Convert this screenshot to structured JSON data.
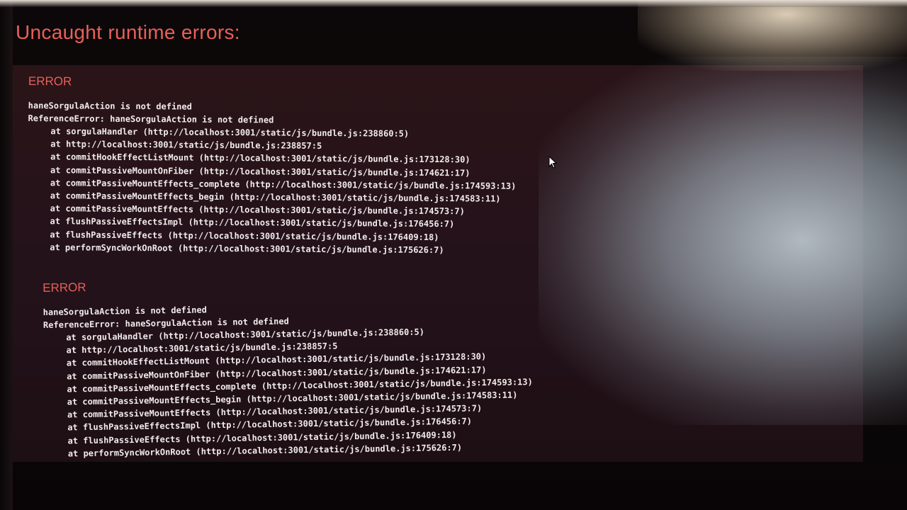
{
  "overlay": {
    "title": "Uncaught runtime errors:"
  },
  "errors": [
    {
      "heading": "ERROR",
      "message": "haneSorgulaAction is not defined",
      "reference_error": "ReferenceError: haneSorgulaAction is not defined",
      "stack": [
        "at sorgulaHandler (http://localhost:3001/static/js/bundle.js:238860:5)",
        "at http://localhost:3001/static/js/bundle.js:238857:5",
        "at commitHookEffectListMount (http://localhost:3001/static/js/bundle.js:173128:30)",
        "at commitPassiveMountOnFiber (http://localhost:3001/static/js/bundle.js:174621:17)",
        "at commitPassiveMountEffects_complete (http://localhost:3001/static/js/bundle.js:174593:13)",
        "at commitPassiveMountEffects_begin (http://localhost:3001/static/js/bundle.js:174583:11)",
        "at commitPassiveMountEffects (http://localhost:3001/static/js/bundle.js:174573:7)",
        "at flushPassiveEffectsImpl (http://localhost:3001/static/js/bundle.js:176456:7)",
        "at flushPassiveEffects (http://localhost:3001/static/js/bundle.js:176409:18)",
        "at performSyncWorkOnRoot (http://localhost:3001/static/js/bundle.js:175626:7)"
      ]
    },
    {
      "heading": "ERROR",
      "message": "haneSorgulaAction is not defined",
      "reference_error": "ReferenceError: haneSorgulaAction is not defined",
      "stack": [
        "at sorgulaHandler (http://localhost:3001/static/js/bundle.js:238860:5)",
        "at http://localhost:3001/static/js/bundle.js:238857:5",
        "at commitHookEffectListMount (http://localhost:3001/static/js/bundle.js:173128:30)",
        "at commitPassiveMountOnFiber (http://localhost:3001/static/js/bundle.js:174621:17)",
        "at commitPassiveMountEffects_complete (http://localhost:3001/static/js/bundle.js:174593:13)",
        "at commitPassiveMountEffects_begin (http://localhost:3001/static/js/bundle.js:174583:11)",
        "at commitPassiveMountEffects (http://localhost:3001/static/js/bundle.js:174573:7)",
        "at flushPassiveEffectsImpl (http://localhost:3001/static/js/bundle.js:176456:7)",
        "at flushPassiveEffects (http://localhost:3001/static/js/bundle.js:176409:18)",
        "at performSyncWorkOnRoot (http://localhost:3001/static/js/bundle.js:175626:7)"
      ]
    }
  ],
  "colors": {
    "title": "#e8605a",
    "heading": "#e8605a",
    "text": "#f2ecec",
    "background": "#1a1012"
  }
}
